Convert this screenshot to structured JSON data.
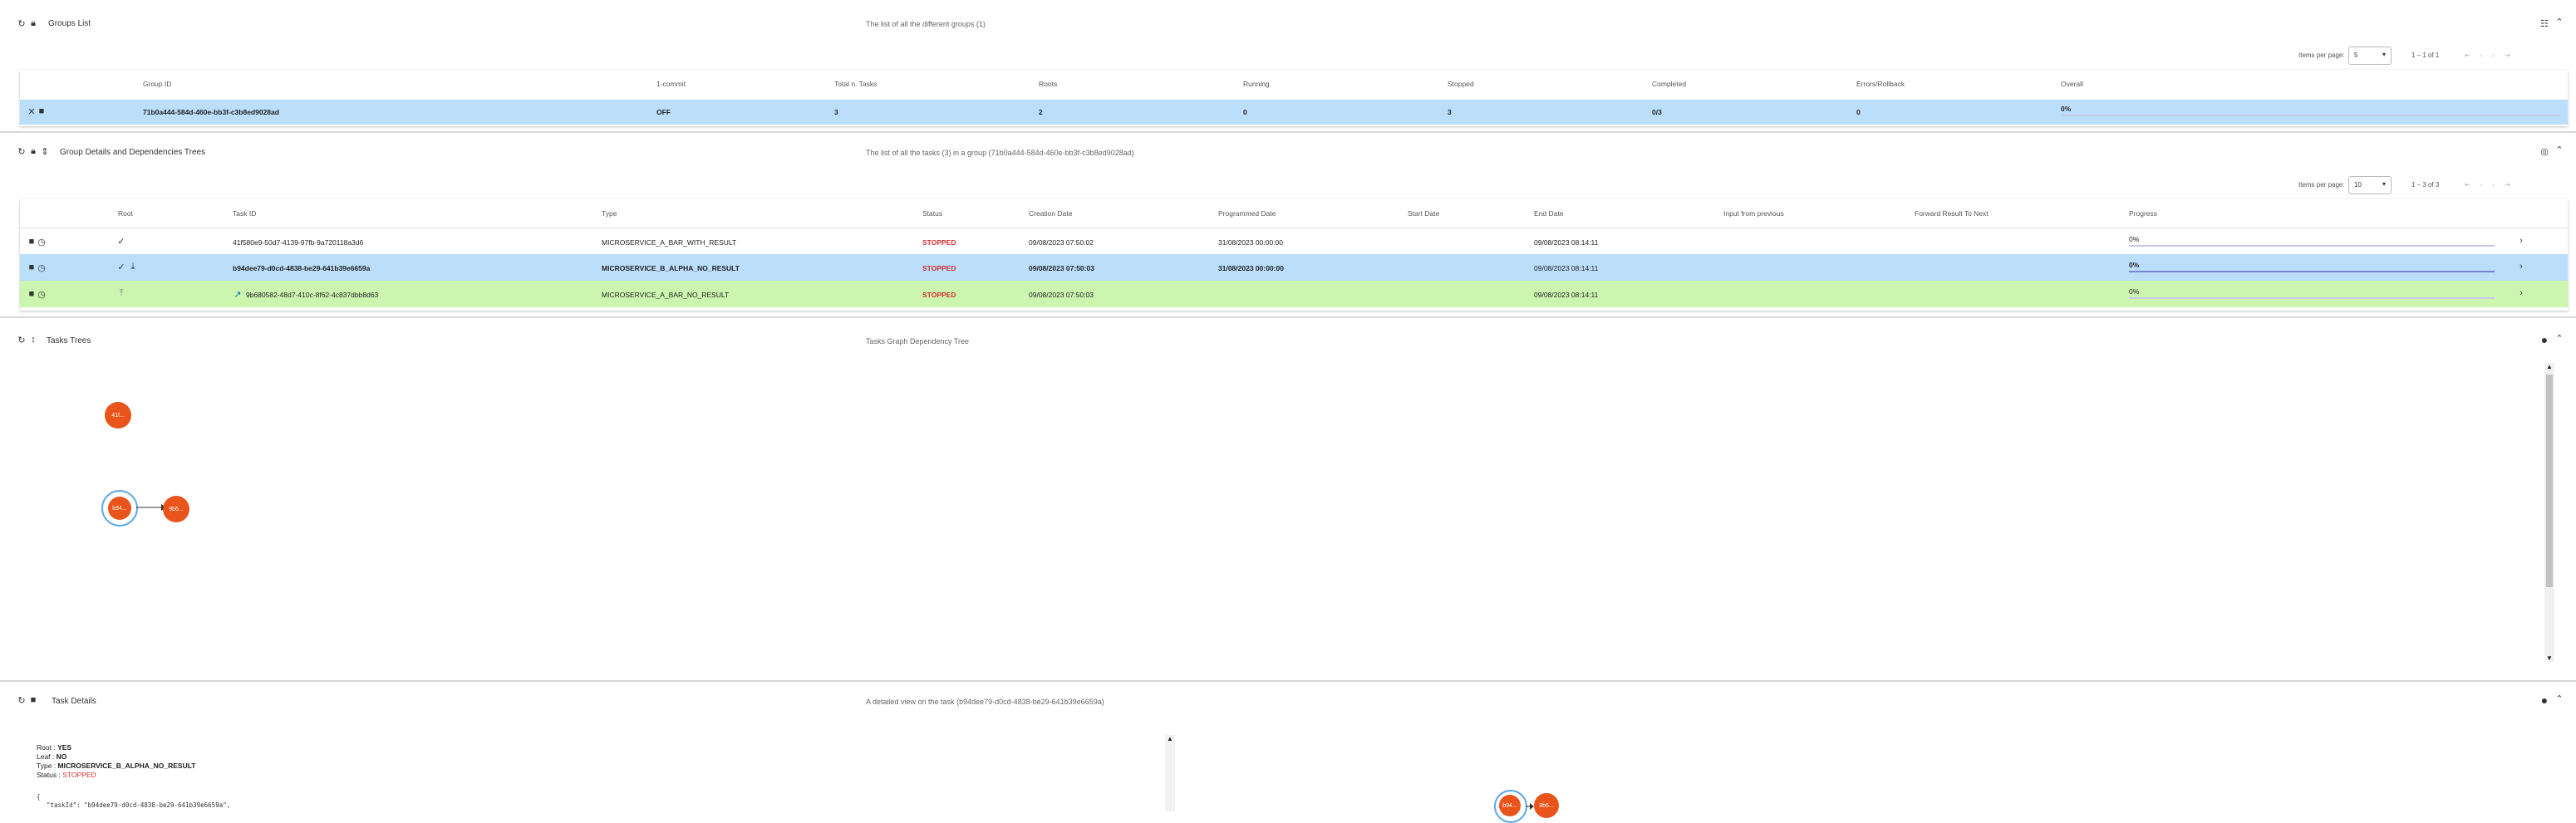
{
  "groups_panel": {
    "title": "Groups List",
    "subtitle": "The list of all the different groups (1)",
    "pager": {
      "items_label": "Items per page:",
      "items_value": "5",
      "range": "1 – 1 of 1"
    },
    "columns": [
      "Group ID",
      "1-commit",
      "Total n. Tasks",
      "Roots",
      "Running",
      "Stopped",
      "Completed",
      "Errors/Rollback",
      "Overall"
    ],
    "row": {
      "group_id": "71b0a444-584d-460e-bb3f-c3b8ed9028ad",
      "commit": "OFF",
      "total": "3",
      "roots": "2",
      "running": "0",
      "stopped": "3",
      "completed": "0/3",
      "errors": "0",
      "overall": "0%"
    }
  },
  "details_panel": {
    "title": "Group Details and Dependencies Trees",
    "subtitle": "The list of all the tasks (3) in a group (71b0a444-584d-460e-bb3f-c3b8ed9028ad)",
    "pager": {
      "items_label": "Items per page:",
      "items_value": "10",
      "range": "1 – 3 of 3"
    },
    "columns": [
      "Root",
      "Task ID",
      "Type",
      "Status",
      "Creation Date",
      "Programmed Date",
      "Start Date",
      "End Date",
      "Input from previous",
      "Forward Result To Next",
      "Progress"
    ],
    "rows": [
      {
        "task_id": "41f580e9-50d7-4139-97fb-9a720118a3d6",
        "type": "MICROSERVICE_A_BAR_WITH_RESULT",
        "status": "STOPPED",
        "creation": "09/08/2023 07:50:02",
        "programmed": "31/08/2023 00:00:00",
        "start": "",
        "end": "09/08/2023 08:14:11",
        "progress": "0%"
      },
      {
        "task_id": "b94dee79-d0cd-4838-be29-641b39e6659a",
        "type": "MICROSERVICE_B_ALPHA_NO_RESULT",
        "status": "STOPPED",
        "creation": "09/08/2023 07:50:03",
        "programmed": "31/08/2023 00:00:00",
        "start": "",
        "end": "09/08/2023 08:14:11",
        "progress": "0%"
      },
      {
        "task_id": "9b680582-48d7-410c-8f62-4c837dbb8d63",
        "type": "MICROSERVICE_A_BAR_NO_RESULT",
        "status": "STOPPED",
        "creation": "09/08/2023 07:50:03",
        "programmed": "",
        "start": "",
        "end": "09/08/2023 08:14:11",
        "progress": "0%"
      }
    ]
  },
  "trees_panel": {
    "title": "Tasks Trees",
    "subtitle": "Tasks Graph Dependency Tree",
    "nodes": [
      "41f...",
      "b94...",
      "9b6..."
    ]
  },
  "task_details_panel": {
    "title": "Task Details",
    "subtitle": "A detailed view on the task (b94dee79-d0cd-4838-be29-641b39e6659a)",
    "root_label": "Root :",
    "root_value": "YES",
    "leaf_label": "Leaf :",
    "leaf_value": "NO",
    "type_label": "Type :",
    "type_value": "MICROSERVICE_B_ALPHA_NO_RESULT",
    "status_label": "Status :",
    "status_value": "STOPPED",
    "json_open": "{",
    "json_line": "\"taskId\": \"b94dee79-d0cd-4838-be29-641b39e6659a\",",
    "nodes": [
      "b94...",
      "9b6..."
    ]
  },
  "colors": {
    "accent_blue": "#bbdefb",
    "accent_green": "#ccf5b0",
    "node_orange": "#e8541a",
    "stopped_red": "#d32f2f"
  },
  "icons": [
    "refresh-icon",
    "lock-icon",
    "expand-icon",
    "grid-icon",
    "chevron-up-icon",
    "close-icon",
    "stop-icon",
    "history-icon",
    "check-icon",
    "download-icon",
    "chevron-right-icon",
    "globe-icon",
    "circle-icon"
  ]
}
